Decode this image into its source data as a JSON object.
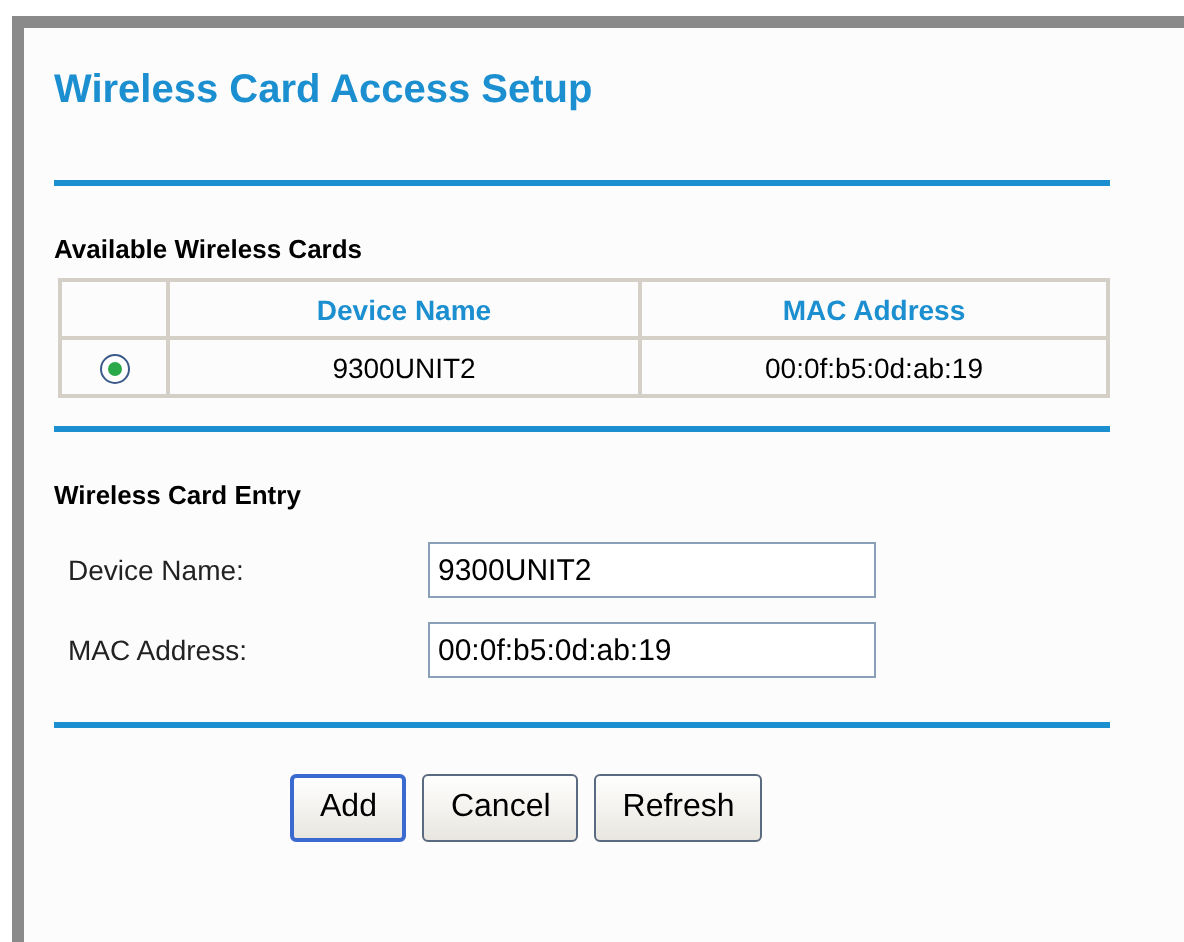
{
  "title": "Wireless Card Access Setup",
  "available": {
    "heading": "Available Wireless Cards",
    "columns": [
      "Device Name",
      "MAC Address"
    ],
    "rows": [
      {
        "selected": true,
        "device_name": "9300UNIT2",
        "mac": "00:0f:b5:0d:ab:19"
      }
    ]
  },
  "entry": {
    "heading": "Wireless Card Entry",
    "fields": [
      {
        "label": "Device Name:",
        "value": "9300UNIT2"
      },
      {
        "label": "MAC Address:",
        "value": "00:0f:b5:0d:ab:19"
      }
    ]
  },
  "buttons": [
    {
      "label": "Add",
      "default": true
    },
    {
      "label": "Cancel",
      "default": false
    },
    {
      "label": "Refresh",
      "default": false
    }
  ]
}
